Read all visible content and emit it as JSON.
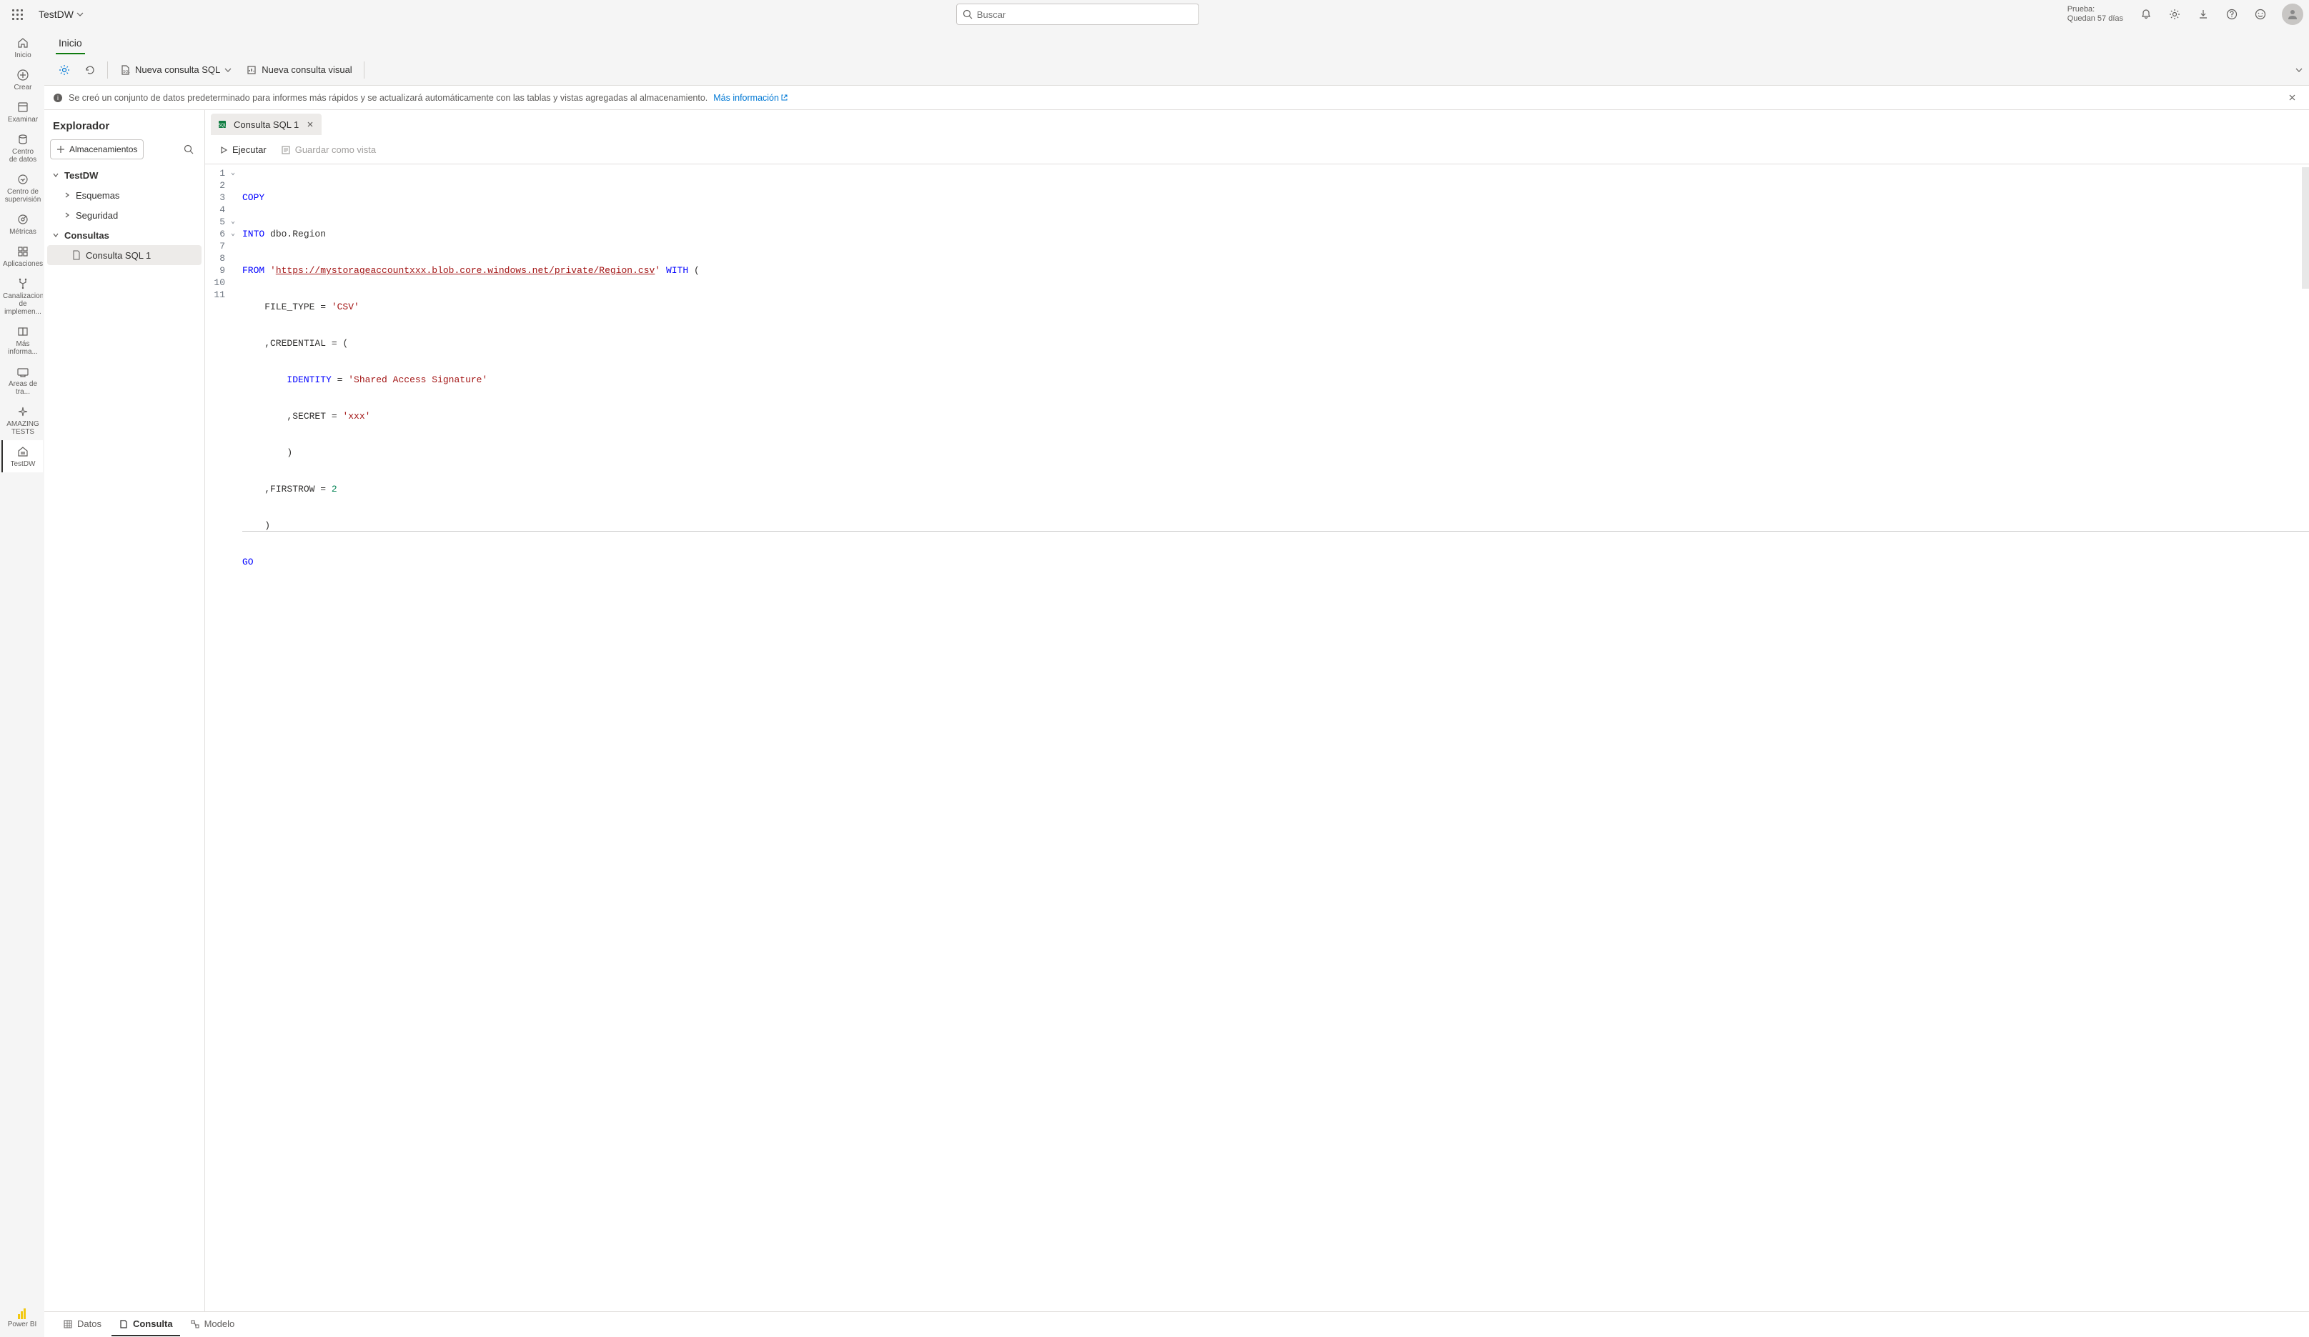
{
  "header": {
    "workspace_name": "TestDW",
    "search_placeholder": "Buscar",
    "trial_line1": "Prueba:",
    "trial_line2": "Quedan 57 días"
  },
  "nav": {
    "home": "Inicio",
    "create": "Crear",
    "browse": "Examinar",
    "data_hub_1": "Centro",
    "data_hub_2": "de datos",
    "monitor_1": "Centro de",
    "monitor_2": "supervisión",
    "metrics": "Métricas",
    "apps": "Aplicaciones",
    "pipelines_1": "Canalizaciones",
    "pipelines_2": "de implemen...",
    "learn": "Más informa...",
    "workspaces": "Áreas de tra...",
    "amazing_1": "AMAZING",
    "amazing_2": "TESTS",
    "testdw": "TestDW",
    "powerbi": "Power BI"
  },
  "commandTabs": {
    "home": "Inicio"
  },
  "commands": {
    "new_sql_query": "Nueva consulta SQL",
    "new_visual_query": "Nueva consulta visual"
  },
  "banner": {
    "text": "Se creó un conjunto de datos predeterminado para informes más rápidos y se actualizará automáticamente con las tablas y vistas agregadas al almacenamiento.",
    "link": "Más información"
  },
  "explorer": {
    "title": "Explorador",
    "storages_btn": "Almacenamientos",
    "tree": {
      "root": "TestDW",
      "schemas": "Esquemas",
      "security": "Seguridad",
      "queries": "Consultas",
      "query1": "Consulta SQL 1"
    }
  },
  "tab": {
    "title": "Consulta SQL 1"
  },
  "editorToolbar": {
    "run": "Ejecutar",
    "save_view": "Guardar como vista"
  },
  "code": {
    "l1": "COPY",
    "l2a": "INTO",
    "l2b": " dbo.Region",
    "l3a": "FROM",
    "l3b": " '",
    "l3url": "https://mystorageaccountxxx.blob.core.windows.net/private/Region.csv",
    "l3c": "'",
    "l3d": " WITH",
    "l3e": " (",
    "l4a": "    FILE_TYPE = ",
    "l4b": "'CSV'",
    "l5a": "    ,CREDENTIAL = (",
    "l6a": "        ",
    "l6b": "IDENTITY",
    "l6c": " = ",
    "l6d": "'Shared Access Signature'",
    "l7a": "        ,SECRET = ",
    "l7b": "'xxx'",
    "l8": "        )",
    "l9a": "    ,FIRSTROW = ",
    "l9b": "2",
    "l10": "    )",
    "l11": "GO"
  },
  "lineNumbers": [
    "1",
    "2",
    "3",
    "4",
    "5",
    "6",
    "7",
    "8",
    "9",
    "10",
    "11"
  ],
  "bottomTabs": {
    "data": "Datos",
    "query": "Consulta",
    "model": "Modelo"
  }
}
